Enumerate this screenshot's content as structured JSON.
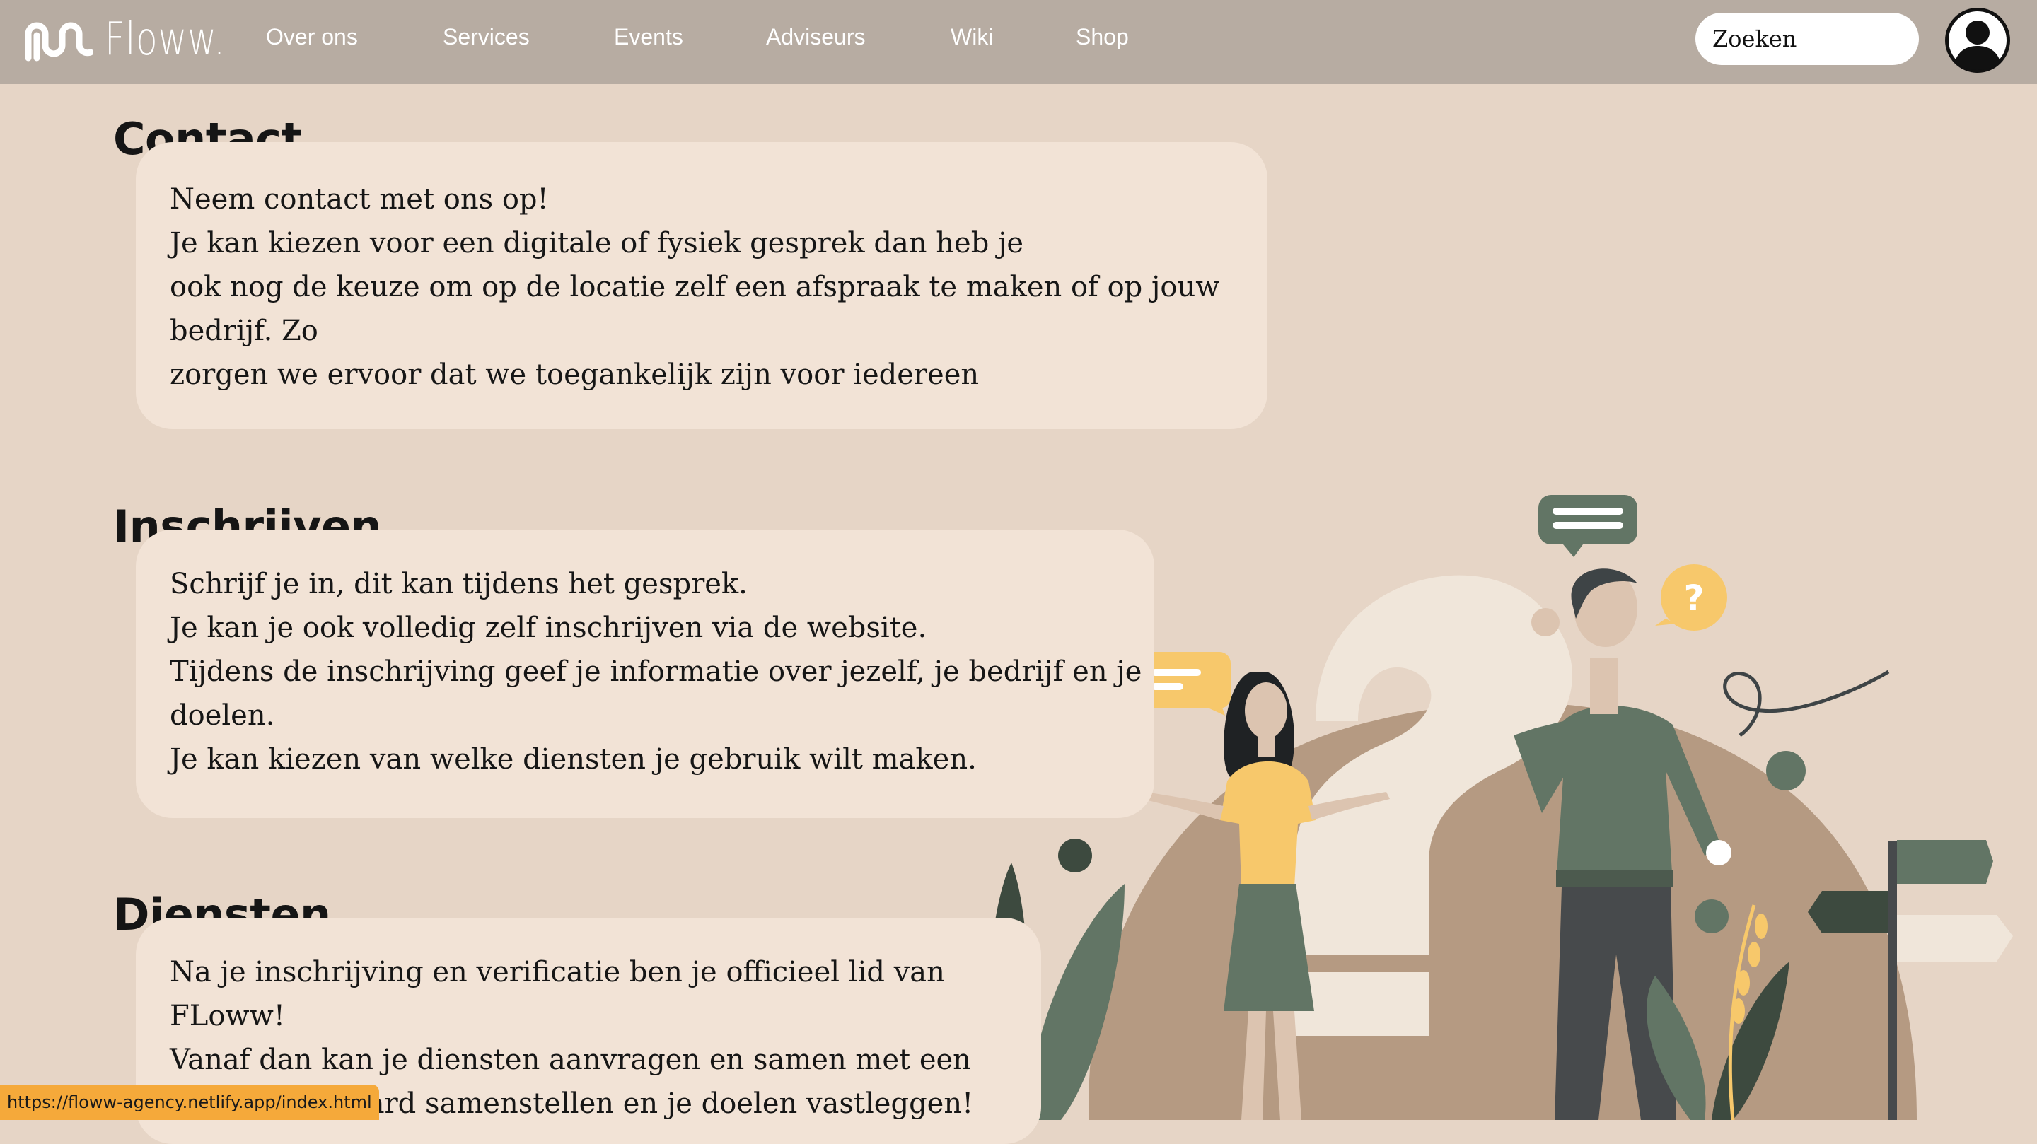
{
  "nav": {
    "logo_text": "Floww.",
    "links": [
      "Over ons",
      "Services",
      "Events",
      "Adviseurs",
      "Wiki",
      "Shop"
    ],
    "search_placeholder": "Zoeken"
  },
  "sections": {
    "contact": {
      "title": "Contact",
      "lines": [
        "Neem contact met ons op!",
        "Je kan kiezen voor een digitale of fysiek gesprek dan heb je",
        "ook nog de keuze om op de locatie zelf een afspraak te maken of op jouw",
        "bedrijf. Zo",
        "zorgen we ervoor dat we toegankelijk zijn voor iedereen"
      ]
    },
    "inschrijven": {
      "title": "Inschrijven",
      "lines": [
        "Schrijf je in, dit kan tijdens het gesprek.",
        "Je kan je ook volledig zelf inschrijven via de website.",
        "Tijdens de inschrijving geef je informatie over jezelf, je bedrijf en je",
        "doelen.",
        "Je kan kiezen van welke diensten je gebruik wilt maken."
      ]
    },
    "diensten": {
      "title": "Diensten",
      "lines": [
        "Na je inschrijving en verificatie ben je officieel lid van",
        "FLoww!",
        "Vanaf dan kan je diensten aanvragen en samen met een",
        "board samenstellen en je doelen vastleggen!"
      ]
    }
  },
  "status_url": "https://floww-agency.netlify.app/index.html",
  "colors": {
    "nav_bg": "#b7aca2",
    "page_bg": "#e6d5c6",
    "card_bg": "#f2e3d6",
    "green": "#627565",
    "yellow": "#f7c86b",
    "brown": "#b59a82",
    "status_bg": "#f5a93a"
  }
}
